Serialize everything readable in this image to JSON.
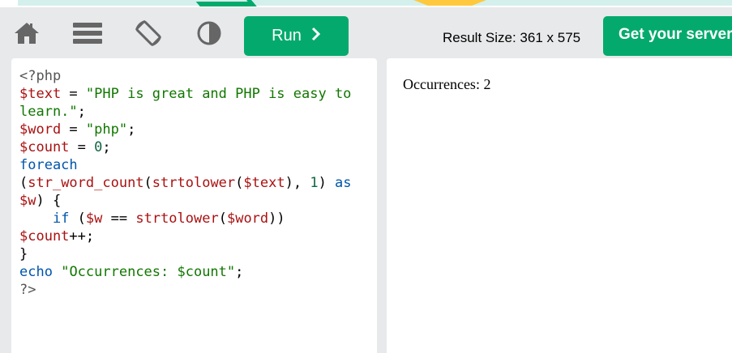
{
  "toolbar": {
    "icons": [
      "home-icon",
      "menu-icon",
      "rotate-icon",
      "contrast-icon"
    ],
    "run_label": "Run",
    "run_icon": "chevron-right-icon",
    "result_size": "Result Size: 361 x 575",
    "server_label": "Get your server"
  },
  "colors": {
    "accent": "#04aa6d",
    "toolbar_bg": "#e7e9eb",
    "keyword": "#0055aa",
    "variable": "#aa1111",
    "string": "#117700",
    "number": "#116644"
  },
  "code": {
    "l1_open": "<?php",
    "l2_var": "$text",
    "l2_op": " = ",
    "l2_str": "\"PHP is great and PHP is easy to",
    "l3_str": "learn.\"",
    "l3_end": ";",
    "l4_var": "$word",
    "l4_op": " = ",
    "l4_str": "\"php\"",
    "l4_end": ";",
    "l5_var": "$count",
    "l5_op": " = ",
    "l5_num": "0",
    "l5_end": ";",
    "l6_kw": "foreach",
    "l7_p1": "(",
    "l7_fn1": "str_word_count",
    "l7_p2": "(",
    "l7_fn2": "strtolower",
    "l7_p3": "(",
    "l7_var": "$text",
    "l7_p4": "), ",
    "l7_num": "1",
    "l7_p5": ") ",
    "l7_kw": "as",
    "l8_var": "$w",
    "l8_p": ") {",
    "l9_indent": "    ",
    "l9_kw": "if",
    "l9_p1": " (",
    "l9_var1": "$w",
    "l9_op": " == ",
    "l9_fn": "strtolower",
    "l9_p2": "(",
    "l9_var2": "$word",
    "l9_p3": "))",
    "l10_var": "$count",
    "l10_op": "++;",
    "l11": "}",
    "l12_kw": "echo",
    "l12_sp": " ",
    "l12_str": "\"Occurrences: $count\"",
    "l12_end": ";",
    "l13_close": "?>"
  },
  "result": {
    "output": "Occurrences: 2"
  }
}
